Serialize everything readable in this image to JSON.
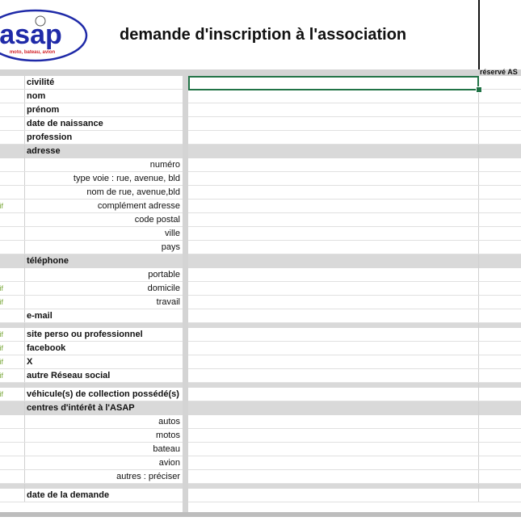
{
  "header": {
    "logo_text": "asap",
    "logo_subtext": "moto, bateau, avion",
    "title": "demande d'inscription à l'association",
    "reserved_label": "réservé AS"
  },
  "optional_marker": "tif",
  "rows": [
    {
      "label": "civilité",
      "style": "bold",
      "optional": false,
      "gray": false
    },
    {
      "label": "nom",
      "style": "bold",
      "optional": false,
      "gray": false
    },
    {
      "label": "prénom",
      "style": "bold",
      "optional": false,
      "gray": false
    },
    {
      "label": "date de naissance",
      "style": "bold",
      "optional": false,
      "gray": false
    },
    {
      "label": "profession",
      "style": "bold",
      "optional": false,
      "gray": false
    },
    {
      "label": "adresse",
      "style": "bold",
      "optional": false,
      "gray": true
    },
    {
      "label": "numéro",
      "style": "sub",
      "optional": false,
      "gray": false
    },
    {
      "label": "type voie : rue, avenue, bld",
      "style": "sub",
      "optional": false,
      "gray": false
    },
    {
      "label": "nom de rue, avenue,bld",
      "style": "sub",
      "optional": false,
      "gray": false
    },
    {
      "label": "complément adresse",
      "style": "sub",
      "optional": true,
      "gray": false
    },
    {
      "label": "code postal",
      "style": "sub",
      "optional": false,
      "gray": false
    },
    {
      "label": "ville",
      "style": "sub",
      "optional": false,
      "gray": false
    },
    {
      "label": "pays",
      "style": "sub",
      "optional": false,
      "gray": false
    },
    {
      "label": "téléphone",
      "style": "bold",
      "optional": false,
      "gray": true
    },
    {
      "label": "portable",
      "style": "sub",
      "optional": false,
      "gray": false
    },
    {
      "label": "domicile",
      "style": "sub",
      "optional": true,
      "gray": false
    },
    {
      "label": "travail",
      "style": "sub",
      "optional": true,
      "gray": false
    },
    {
      "label": "e-mail",
      "style": "bold",
      "optional": false,
      "gray": false
    },
    {
      "label": "",
      "style": "spacer",
      "optional": false,
      "gray": true
    },
    {
      "label": "site perso ou professionnel",
      "style": "bold",
      "optional": true,
      "gray": false
    },
    {
      "label": "facebook",
      "style": "bold",
      "optional": true,
      "gray": false
    },
    {
      "label": "X",
      "style": "bold",
      "optional": true,
      "gray": false
    },
    {
      "label": "autre Réseau social",
      "style": "bold",
      "optional": true,
      "gray": false
    },
    {
      "label": "",
      "style": "spacer",
      "optional": false,
      "gray": true
    },
    {
      "label": "véhicule(s) de collection possédé(s)",
      "style": "bold",
      "optional": true,
      "gray": false
    },
    {
      "label": "centres d'intérêt à l'ASAP",
      "style": "bold",
      "optional": false,
      "gray": true
    },
    {
      "label": "autos",
      "style": "sub",
      "optional": false,
      "gray": false
    },
    {
      "label": "motos",
      "style": "sub",
      "optional": false,
      "gray": false
    },
    {
      "label": "bateau",
      "style": "sub",
      "optional": false,
      "gray": false
    },
    {
      "label": "avion",
      "style": "sub",
      "optional": false,
      "gray": false
    },
    {
      "label": "autres : préciser",
      "style": "sub",
      "optional": false,
      "gray": false
    },
    {
      "label": "",
      "style": "spacer",
      "optional": false,
      "gray": true
    },
    {
      "label": "date de la demande",
      "style": "bold",
      "optional": false,
      "gray": false
    }
  ],
  "colors": {
    "logo_blue": "#1f2aa8",
    "logo_red": "#d2232a",
    "selection_green": "#217346",
    "optional_green": "#7aa83a",
    "gray_band": "#d9d9d9"
  }
}
